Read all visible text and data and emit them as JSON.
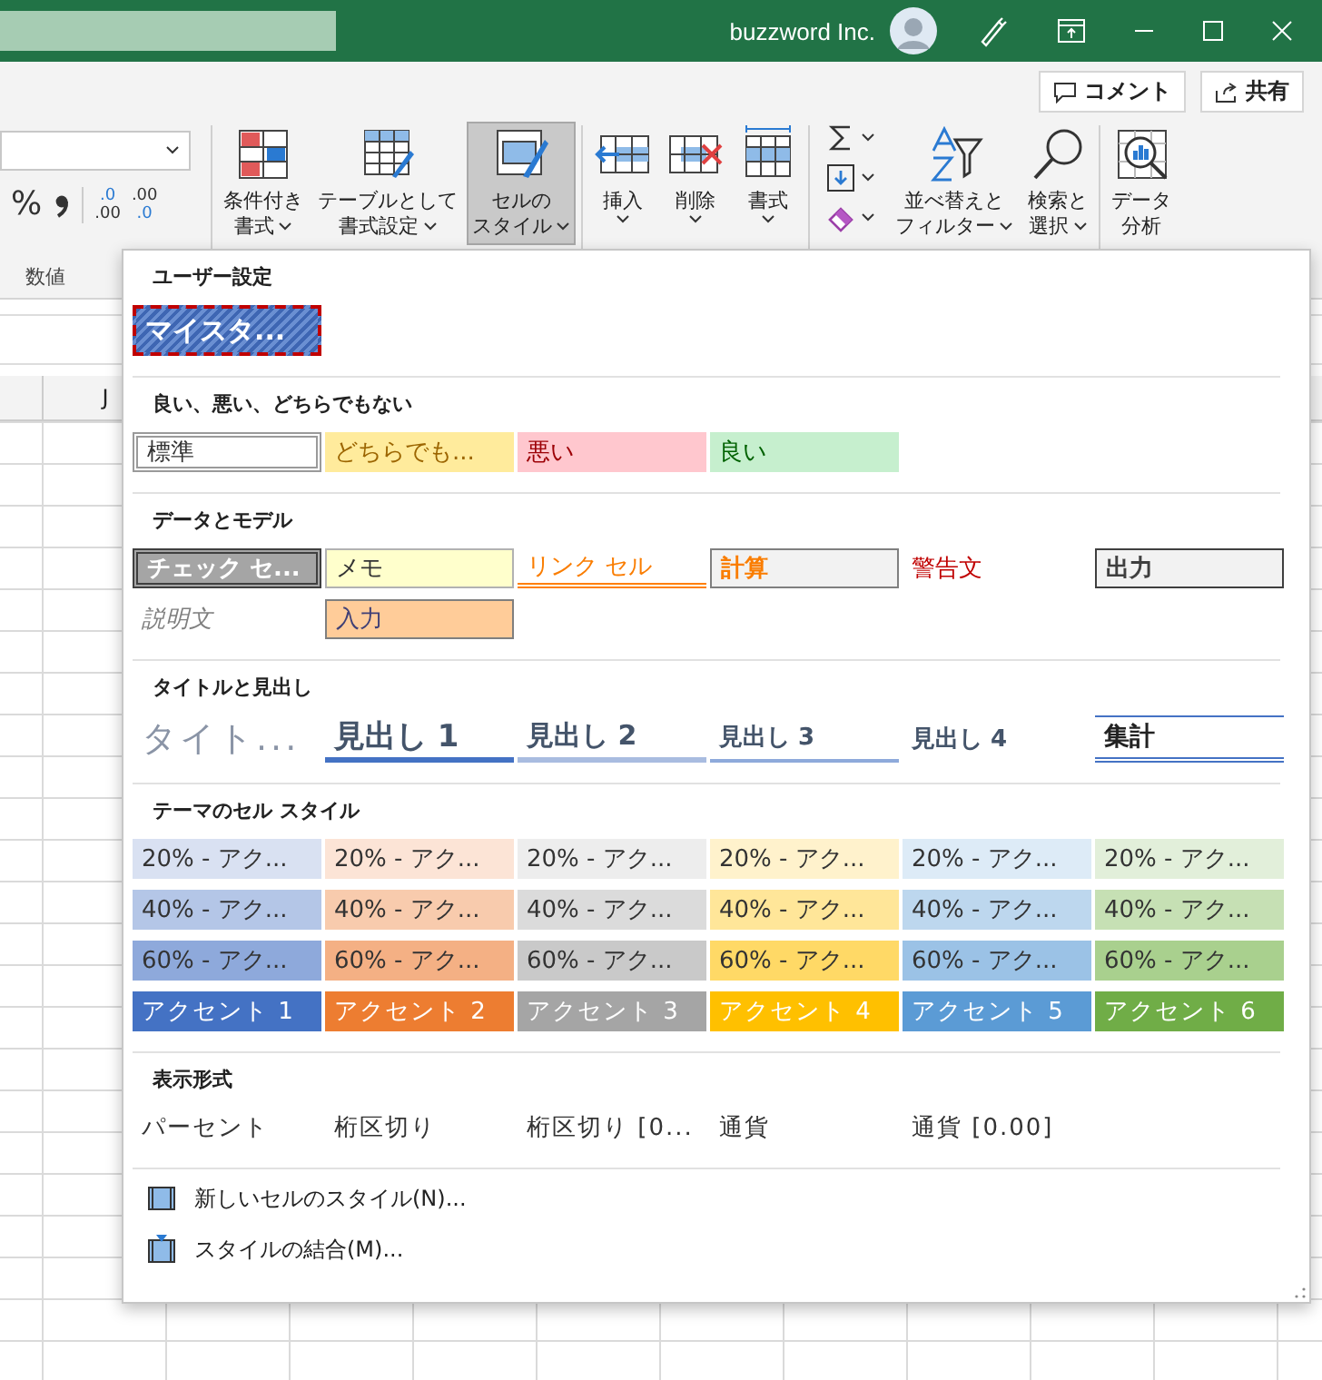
{
  "title_bar": {
    "account": "buzzword Inc."
  },
  "ribbon": {
    "top_buttons": [
      {
        "kind": "comment",
        "label": "コメント"
      },
      {
        "kind": "share",
        "label": "共有"
      }
    ],
    "number_group": {
      "label": "数値",
      "percent": "%",
      "decimal_buttons": [
        {
          "kind": "increase",
          "lines": [
            ".0",
            ".00"
          ]
        },
        {
          "kind": "decrease",
          "lines": [
            ".00",
            ".0"
          ]
        }
      ]
    },
    "groups": [
      [
        {
          "kind": "conditional",
          "lines": [
            "条件付き",
            "書式"
          ],
          "dropdown": true,
          "selected": false
        },
        {
          "kind": "table",
          "lines": [
            "テーブルとして",
            "書式設定"
          ],
          "dropdown": true,
          "selected": false
        },
        {
          "kind": "cellstyle",
          "lines": [
            "セルの",
            "スタイル"
          ],
          "dropdown": true,
          "selected": true
        }
      ],
      [
        {
          "kind": "insert",
          "lines": [
            "挿入"
          ],
          "dropdown": true,
          "selected": false
        },
        {
          "kind": "delete",
          "lines": [
            "削除"
          ],
          "dropdown": true,
          "selected": false
        },
        {
          "kind": "format",
          "lines": [
            "書式"
          ],
          "dropdown": true,
          "selected": false
        }
      ],
      [
        {
          "kind": "editing",
          "tools": [
            {
              "kind": "sum",
              "dropdown": true
            },
            {
              "kind": "fill",
              "dropdown": true
            },
            {
              "kind": "clear",
              "dropdown": true
            }
          ]
        },
        {
          "kind": "sort",
          "lines": [
            "並べ替えと",
            "フィルター"
          ],
          "dropdown": true,
          "selected": false
        },
        {
          "kind": "find",
          "lines": [
            "検索と",
            "選択"
          ],
          "dropdown": true,
          "selected": false
        }
      ],
      [
        {
          "kind": "analysis",
          "lines": [
            "データ",
            "分析"
          ],
          "dropdown": false,
          "selected": false
        }
      ]
    ]
  },
  "sheet": {
    "column_headers": [
      "J"
    ]
  },
  "style_menu": {
    "sections": [
      {
        "title": "ユーザー設定",
        "items": [
          {
            "kind": "custom",
            "label": "マイスタ...",
            "selected": true
          }
        ]
      },
      {
        "title": "良い、悪い、どちらでもない",
        "items": [
          {
            "kind": "normal",
            "label": "標準"
          },
          {
            "kind": "neutral",
            "label": "どちらでも..."
          },
          {
            "kind": "bad",
            "label": "悪い"
          },
          {
            "kind": "good",
            "label": "良い"
          }
        ]
      },
      {
        "title": "データとモデル",
        "items": [
          {
            "kind": "check",
            "label": "チェック セ..."
          },
          {
            "kind": "note",
            "label": "メモ"
          },
          {
            "kind": "linked",
            "label": "リンク セル"
          },
          {
            "kind": "calc",
            "label": "計算"
          },
          {
            "kind": "warn",
            "label": "警告文"
          },
          {
            "kind": "output",
            "label": "出力"
          },
          {
            "kind": "explain",
            "label": "説明文"
          },
          {
            "kind": "input",
            "label": "入力"
          }
        ]
      },
      {
        "title": "タイトルと見出し",
        "items": [
          {
            "kind": "title",
            "label": "タイト..."
          },
          {
            "kind": "h1",
            "label": "見出し 1"
          },
          {
            "kind": "h2",
            "label": "見出し 2"
          },
          {
            "kind": "h3",
            "label": "見出し 3"
          },
          {
            "kind": "h4",
            "label": "見出し 4"
          },
          {
            "kind": "total",
            "label": "集計"
          }
        ]
      },
      {
        "title": "テーマのセル スタイル",
        "items": [
          {
            "kind": "tint",
            "label": "20% - アク...",
            "color": "#d9e1f2"
          },
          {
            "kind": "tint",
            "label": "20% - アク...",
            "color": "#fce4d6"
          },
          {
            "kind": "tint",
            "label": "20% - アク...",
            "color": "#ededed"
          },
          {
            "kind": "tint",
            "label": "20% - アク...",
            "color": "#fff2cc"
          },
          {
            "kind": "tint",
            "label": "20% - アク...",
            "color": "#ddebf7"
          },
          {
            "kind": "tint",
            "label": "20% - アク...",
            "color": "#e2efda"
          },
          {
            "kind": "tint",
            "label": "40% - アク...",
            "color": "#b4c6e7"
          },
          {
            "kind": "tint",
            "label": "40% - アク...",
            "color": "#f8cbad"
          },
          {
            "kind": "tint",
            "label": "40% - アク...",
            "color": "#dbdbdb"
          },
          {
            "kind": "tint",
            "label": "40% - アク...",
            "color": "#ffe699"
          },
          {
            "kind": "tint",
            "label": "40% - アク...",
            "color": "#bdd7ee"
          },
          {
            "kind": "tint",
            "label": "40% - アク...",
            "color": "#c6e0b4"
          },
          {
            "kind": "tint",
            "label": "60% - アク...",
            "color": "#8ea9db"
          },
          {
            "kind": "tint",
            "label": "60% - アク...",
            "color": "#f4b084"
          },
          {
            "kind": "tint",
            "label": "60% - アク...",
            "color": "#c9c9c9"
          },
          {
            "kind": "tint",
            "label": "60% - アク...",
            "color": "#ffd966"
          },
          {
            "kind": "tint",
            "label": "60% - アク...",
            "color": "#9bc2e6"
          },
          {
            "kind": "tint",
            "label": "60% - アク...",
            "color": "#a9d08e"
          },
          {
            "kind": "accent",
            "label": "アクセント 1",
            "color": "#4472c4"
          },
          {
            "kind": "accent",
            "label": "アクセント 2",
            "color": "#ed7d31"
          },
          {
            "kind": "accent",
            "label": "アクセント 3",
            "color": "#a5a5a5"
          },
          {
            "kind": "accent",
            "label": "アクセント 4",
            "color": "#ffc000"
          },
          {
            "kind": "accent",
            "label": "アクセント 5",
            "color": "#5b9bd5"
          },
          {
            "kind": "accent",
            "label": "アクセント 6",
            "color": "#70ad47"
          }
        ]
      },
      {
        "title": "表示形式",
        "items": [
          {
            "kind": "plain",
            "label": "パーセント"
          },
          {
            "kind": "plain",
            "label": "桁区切り"
          },
          {
            "kind": "plain",
            "label": "桁区切り [0..."
          },
          {
            "kind": "plain",
            "label": "通貨"
          },
          {
            "kind": "plain",
            "label": "通貨 [0.00]"
          }
        ]
      }
    ],
    "commands": [
      {
        "kind": "new",
        "label": "新しいセルのスタイル(N)..."
      },
      {
        "kind": "merge",
        "label": "スタイルの結合(M)..."
      }
    ]
  }
}
